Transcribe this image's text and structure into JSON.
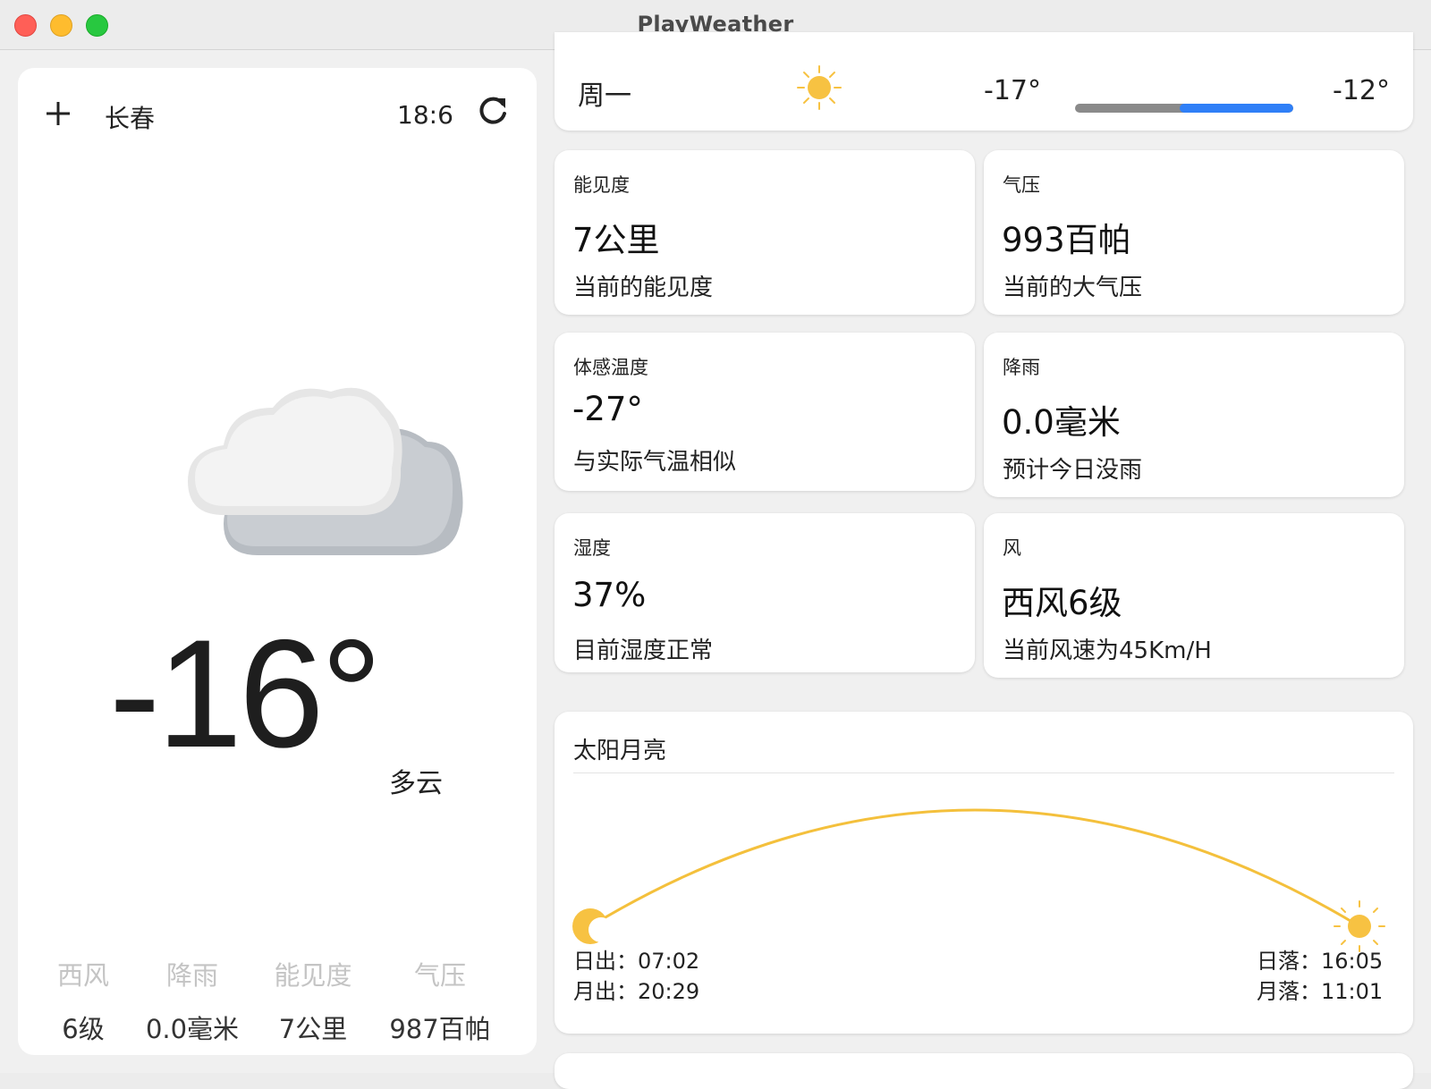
{
  "window": {
    "title": "PlayWeather"
  },
  "current": {
    "city": "长春",
    "time": "18:6",
    "temperature": "-16°",
    "condition": "多云",
    "icon": "cloudy-icon",
    "stats": [
      {
        "label": "西风",
        "value": "6级"
      },
      {
        "label": "降雨",
        "value": "0.0毫米"
      },
      {
        "label": "能见度",
        "value": "7公里"
      },
      {
        "label": "气压",
        "value": "987百帕"
      }
    ]
  },
  "forecast": {
    "day": "周一",
    "icon": "sun-icon",
    "low": "-17°",
    "high": "-12°",
    "range_fill_fraction": 0.52
  },
  "details": [
    {
      "label": "能见度",
      "value": "7公里",
      "desc": "当前的能见度"
    },
    {
      "label": "气压",
      "value": "993百帕",
      "desc": "当前的大气压"
    },
    {
      "label": "体感温度",
      "value": "-27°",
      "desc": "与实际气温相似"
    },
    {
      "label": "降雨",
      "value": "0.0毫米",
      "desc": "预计今日没雨"
    },
    {
      "label": "湿度",
      "value": "37%",
      "desc": "目前湿度正常"
    },
    {
      "label": "风",
      "value": "西风6级",
      "desc": "当前风速为45Km/H"
    }
  ],
  "sun_moon": {
    "title": "太阳月亮",
    "sunrise": "日出：07:02",
    "moonrise": "月出：20:29",
    "sunset": "日落：16:05",
    "moonset": "月落：11:01"
  },
  "colors": {
    "accent_blue": "#2f7ff7",
    "sun_yellow": "#f7c242",
    "arc_yellow": "#f4c03c"
  }
}
